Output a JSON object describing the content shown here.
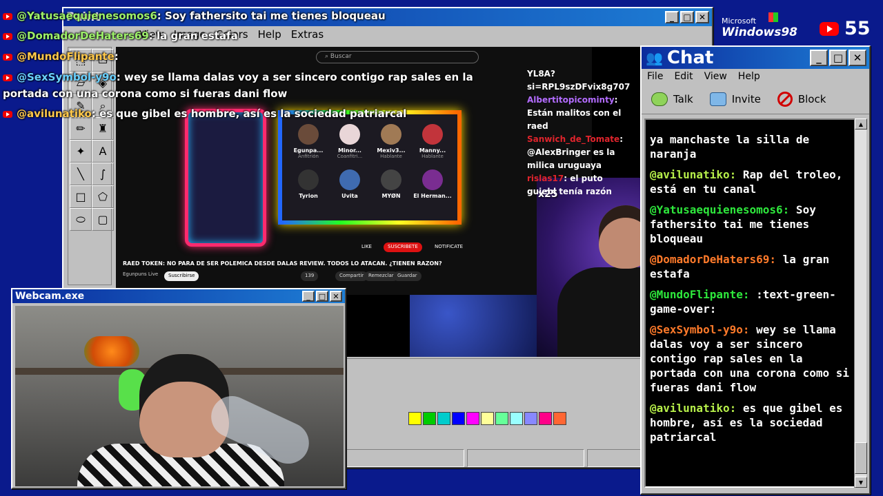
{
  "overlay_chat": [
    {
      "user": "@Yatusaequienesomos6",
      "text": ": Soy fathersito tai me tienes bloqueau"
    },
    {
      "user": "@DomadorDeHaters69",
      "text": ": la gran estafa"
    },
    {
      "user": "@MundoFlipante",
      "text": ":"
    },
    {
      "user": "@SexSymbol-y9o",
      "text": ": wey se llama dalas voy a ser sincero contigo rap sales en la"
    },
    {
      "user": "",
      "text": "portada con una corona como si fueras dani flow"
    },
    {
      "user": "@avilunatiko",
      "text": ": es que gibel es hombre, así es la sociedad patriarcal"
    }
  ],
  "paint": {
    "title": "Paint",
    "menu": [
      "View",
      "Image",
      "Colors",
      "Help",
      "Extras"
    ],
    "palette": [
      "#ffff00",
      "#00cc00",
      "#00cccc",
      "#0000ff",
      "#ff00ff",
      "#ffff99",
      "#66ff99",
      "#99ffff",
      "#8888ff",
      "#ff0088",
      "#ff6633"
    ],
    "stream": {
      "search_placeholder": "Buscar",
      "guests": [
        {
          "name": "Egunpa...",
          "role": "Anfitrión"
        },
        {
          "name": "Minor...",
          "role": "Coanfitri..."
        },
        {
          "name": "Mexiv3...",
          "role": "Hablante"
        },
        {
          "name": "Manny...",
          "role": "Hablante"
        },
        {
          "name": "Tyrion",
          "role": ""
        },
        {
          "name": "Uvita",
          "role": ""
        },
        {
          "name": "MYØN",
          "role": ""
        },
        {
          "name": "El Herman...",
          "role": ""
        }
      ],
      "video_title": "RAED TOKEN: NO PARA DE SER POLEMICA DESDE DALAS REVIEW. TODOS LO ATACAN. ¿TIENEN RAZON?",
      "channel": "Egunpuns Live",
      "subscribe": "Suscribirse",
      "actions": [
        "139",
        "Compartir",
        "Remezclar",
        "Guardar"
      ],
      "like": "LIKE",
      "suscribe_badge": "SUSCRIBETE",
      "notify": "NOTIFICATE",
      "combo": "x25",
      "twitch_chat": [
        {
          "user": "",
          "text": "YL8A?si=RPL9szDFvix8g707"
        },
        {
          "user": "Albertitopicominty",
          "text": ": Están malitos con el raed"
        },
        {
          "user": "Sanwich_de_Tomate",
          "text": ": @AlexBringer es la milica uruguaya"
        },
        {
          "user": "rislas17",
          "text": ": el puto guiebl tenía razón"
        }
      ]
    }
  },
  "chat": {
    "title": "Chat",
    "menu": [
      "File",
      "Edit",
      "View",
      "Help"
    ],
    "toolbar": {
      "talk": "Talk",
      "invite": "Invite",
      "block": "Block"
    },
    "messages": [
      {
        "user": "",
        "text": "ya manchaste la silla de naranja",
        "color": "green"
      },
      {
        "user": "@avilunatiko:",
        "text": " Rap del troleo, está en tu canal",
        "color": "lime"
      },
      {
        "user": "@Yatusaequienesomos6:",
        "text": " Soy fathersito tai me tienes bloqueau",
        "color": "green"
      },
      {
        "user": "@DomadorDeHaters69:",
        "text": " la gran estafa",
        "color": "lime"
      },
      {
        "user": "@MundoFlipante:",
        "text": " :text-green-game-over:",
        "color": "green"
      },
      {
        "user": "@SexSymbol-y9o:",
        "text": " wey se llama dalas voy a ser sincero contigo rap sales en la portada con una corona como si fueras dani flow",
        "color": "orange"
      },
      {
        "user": "@avilunatiko:",
        "text": " es que gibel es hombre, así es la sociedad patriarcal",
        "color": "lime"
      }
    ]
  },
  "webcam": {
    "title": "Webcam.exe"
  },
  "brand": {
    "microsoft": "Microsoft",
    "windows": "Windows98"
  },
  "viewers": "55"
}
